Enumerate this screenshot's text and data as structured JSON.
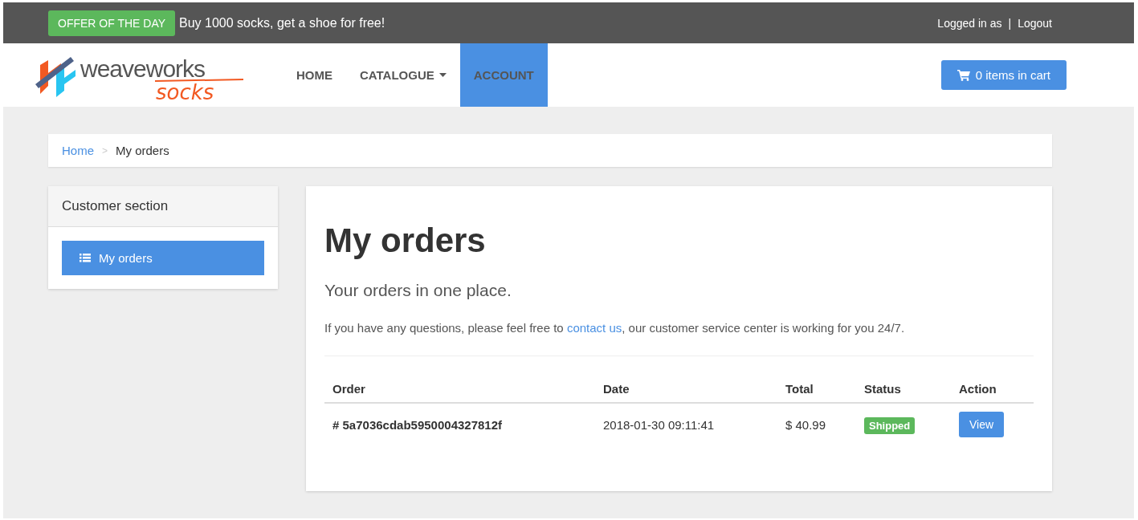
{
  "top_bar": {
    "offer_badge": "OFFER OF THE DAY",
    "offer_text": "Buy 1000 socks, get a shoe for free!",
    "login_text": "Logged in as",
    "separator": "|",
    "logout": "Logout"
  },
  "logo": {
    "name": "weaveworks",
    "tag": "socks"
  },
  "nav": [
    {
      "label": "HOME",
      "selected": false,
      "dropdown": false
    },
    {
      "label": "CATALOGUE",
      "selected": false,
      "dropdown": true
    },
    {
      "label": "ACCOUNT",
      "selected": true,
      "dropdown": false
    }
  ],
  "cart_button": "0 items in cart",
  "breadcrumb": [
    {
      "label": "Home",
      "link": true
    },
    {
      "label": "My orders",
      "link": false
    }
  ],
  "breadcrumb_separator": ">",
  "sidebar": {
    "title": "Customer section",
    "items": [
      {
        "label": "My orders",
        "selected": true
      }
    ]
  },
  "main": {
    "title": "My orders",
    "subtitle": "Your orders in one place.",
    "info_before": "If you have any questions, please feel free to ",
    "info_link": "contact us",
    "info_after": ", our customer service center is working for you 24/7.",
    "table": {
      "columns": [
        "Order",
        "Date",
        "Total",
        "Status",
        "Action"
      ],
      "rows": [
        {
          "order": "# 5a7036cdab5950004327812f",
          "date": "2018-01-30 09:11:41",
          "total": "$ 40.99",
          "status": "Shipped",
          "color": "#5cb85c",
          "action": "View"
        }
      ]
    }
  }
}
